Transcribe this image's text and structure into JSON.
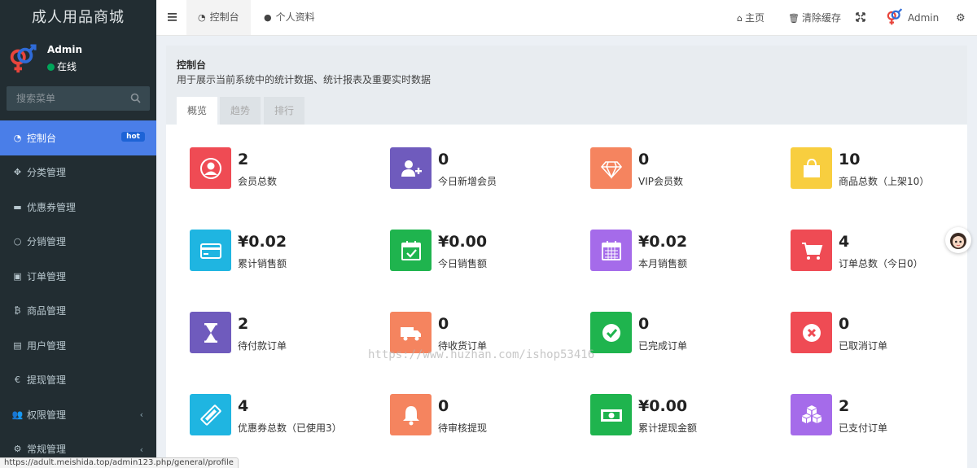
{
  "sidebar": {
    "brand": "成人用品商城",
    "user_name": "Admin",
    "user_status": "在线",
    "search_placeholder": "搜索菜单",
    "items": [
      {
        "label": "控制台",
        "icon": "dashboard-icon",
        "badge": "hot",
        "active": true
      },
      {
        "label": "分类管理",
        "icon": "arrows-icon"
      },
      {
        "label": "优惠券管理",
        "icon": "credit-card-icon"
      },
      {
        "label": "分销管理",
        "icon": "circle-icon"
      },
      {
        "label": "订单管理",
        "icon": "image-icon"
      },
      {
        "label": "商品管理",
        "icon": "bitcoin-icon"
      },
      {
        "label": "用户管理",
        "icon": "address-book-icon"
      },
      {
        "label": "提现管理",
        "icon": "euro-icon"
      },
      {
        "label": "权限管理",
        "icon": "users-icon",
        "arrow": "‹"
      },
      {
        "label": "常规管理",
        "icon": "cogs-icon",
        "arrow": "‹"
      }
    ]
  },
  "topnav": {
    "tabs": [
      {
        "label": "控制台",
        "icon": "dashboard-icon",
        "active": true
      },
      {
        "label": "个人资料",
        "icon": "user-icon"
      }
    ],
    "home": "主页",
    "clear_cache": "清除缓存",
    "admin": "Admin"
  },
  "header": {
    "title": "控制台",
    "description": "用于展示当前系统中的统计数据、统计报表及重要实时数据",
    "tabs": [
      "概览",
      "趋势",
      "排行"
    ]
  },
  "stats": [
    {
      "value": "2",
      "label": "会员总数",
      "color": "#ef4b54",
      "icon": "user-circle-icon"
    },
    {
      "value": "0",
      "label": "今日新增会员",
      "color": "#6f5bbd",
      "icon": "user-plus-icon"
    },
    {
      "value": "0",
      "label": "VIP会员数",
      "color": "#f5845f",
      "icon": "diamond-icon"
    },
    {
      "value": "10",
      "label": "商品总数（上架10）",
      "color": "#f8ce3f",
      "icon": "shopping-bag-icon"
    },
    {
      "value": "¥0.02",
      "label": "累计销售额",
      "color": "#1fb5e1",
      "icon": "credit-card-icon"
    },
    {
      "value": "¥0.00",
      "label": "今日销售额",
      "color": "#1fb44e",
      "icon": "calendar-check-icon"
    },
    {
      "value": "¥0.02",
      "label": "本月销售额",
      "color": "#a56bea",
      "icon": "calendar-icon"
    },
    {
      "value": "4",
      "label": "订单总数（今日0）",
      "color": "#ef4b54",
      "icon": "cart-icon"
    },
    {
      "value": "2",
      "label": "待付款订单",
      "color": "#6f5bbd",
      "icon": "hourglass-icon"
    },
    {
      "value": "0",
      "label": "待收货订单",
      "color": "#f5845f",
      "icon": "truck-icon"
    },
    {
      "value": "0",
      "label": "已完成订单",
      "color": "#1fb44e",
      "icon": "check-circle-icon"
    },
    {
      "value": "0",
      "label": "已取消订单",
      "color": "#ef4b54",
      "icon": "times-circle-icon"
    },
    {
      "value": "4",
      "label": "优惠券总数（已使用3）",
      "color": "#1fb5e1",
      "icon": "ticket-icon"
    },
    {
      "value": "0",
      "label": "待审核提现",
      "color": "#f5845f",
      "icon": "bell-icon"
    },
    {
      "value": "¥0.00",
      "label": "累计提现金额",
      "color": "#1fb44e",
      "icon": "money-icon"
    },
    {
      "value": "2",
      "label": "已支付订单",
      "color": "#a56bea",
      "icon": "cubes-icon"
    }
  ],
  "watermark": "https://www.huzhan.com/ishop53416",
  "statusbar": "https://adult.meishida.top/admin123.php/general/profile"
}
